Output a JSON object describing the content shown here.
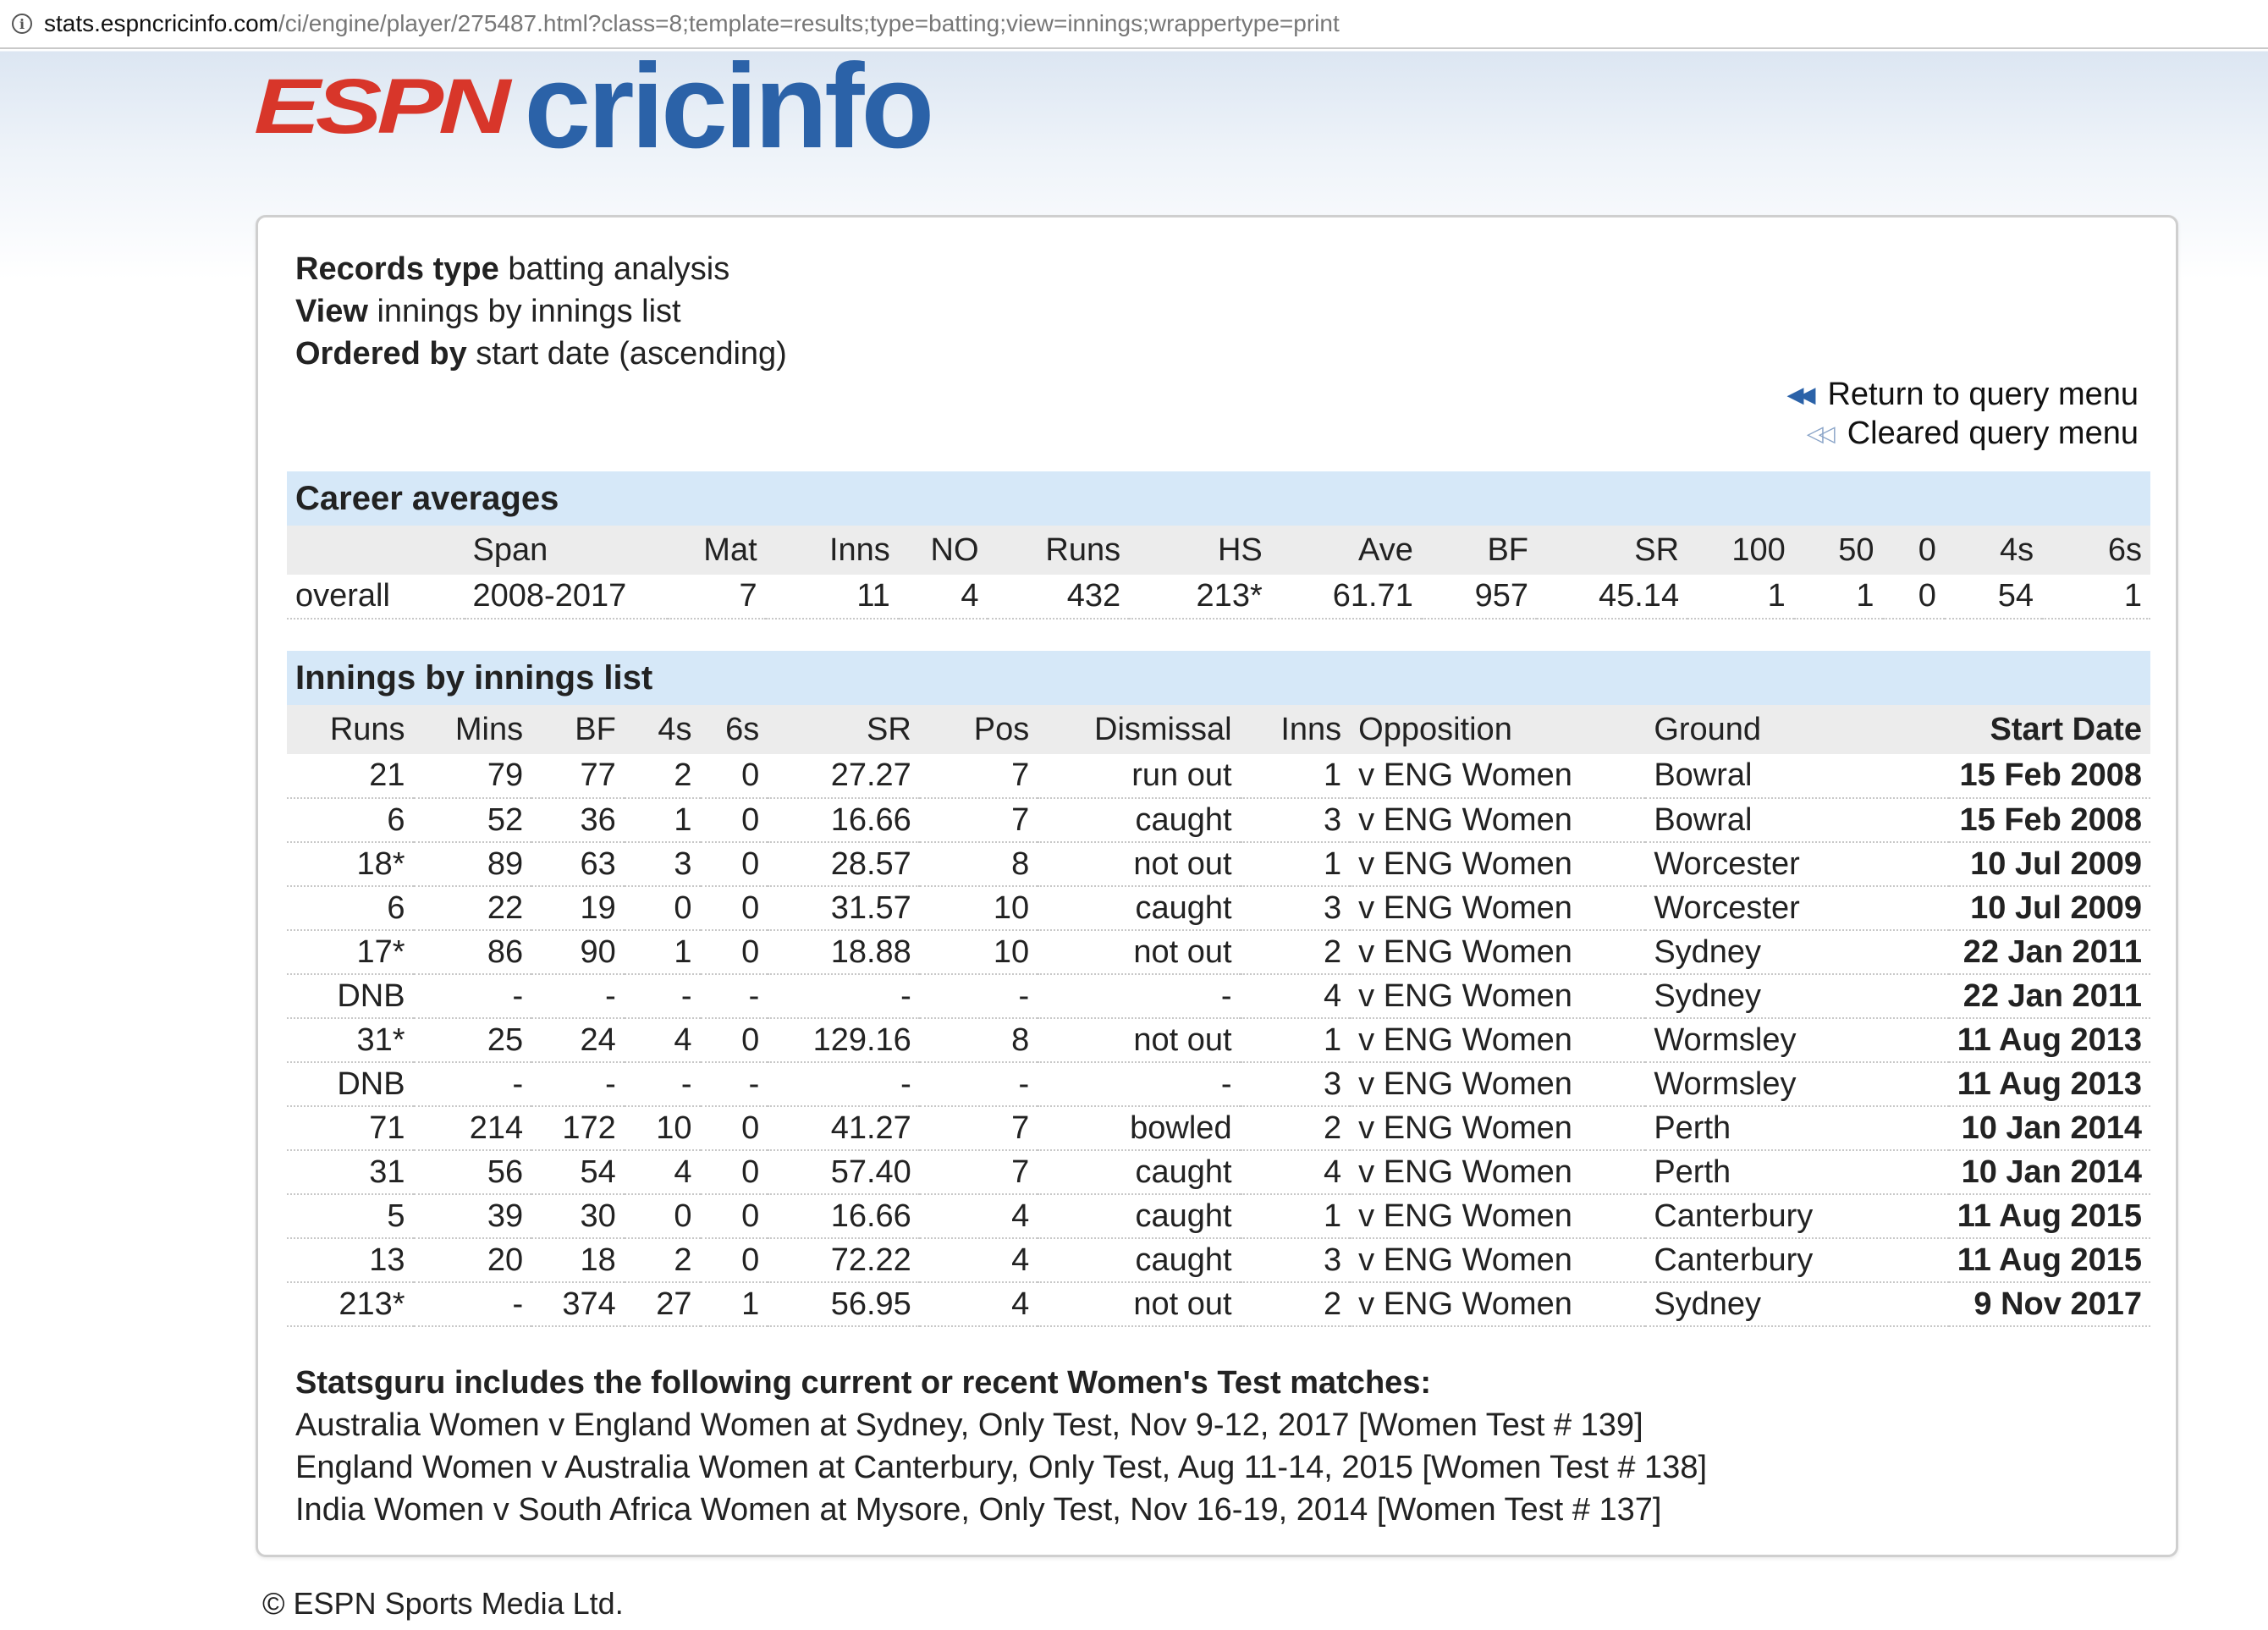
{
  "browser": {
    "url_host": "stats.espncricinfo.com",
    "url_path": "/ci/engine/player/275487.html?class=8;template=results;type=batting;view=innings;wrappertype=print"
  },
  "logo": {
    "espn": "ESPN",
    "cricinfo": "cricinfo"
  },
  "meta": {
    "records_type_label": "Records type",
    "records_type_value": "batting analysis",
    "view_label": "View",
    "view_value": "innings by innings list",
    "ordered_by_label": "Ordered by",
    "ordered_by_value": "start date (ascending)"
  },
  "links": {
    "return": "Return to query menu",
    "cleared": "Cleared query menu"
  },
  "career": {
    "title": "Career averages",
    "headers": [
      "",
      "Span",
      "Mat",
      "Inns",
      "NO",
      "Runs",
      "HS",
      "Ave",
      "BF",
      "SR",
      "100",
      "50",
      "0",
      "4s",
      "6s"
    ],
    "row": [
      "overall",
      "2008-2017",
      "7",
      "11",
      "4",
      "432",
      "213*",
      "61.71",
      "957",
      "45.14",
      "1",
      "1",
      "0",
      "54",
      "1"
    ]
  },
  "innings": {
    "title": "Innings by innings list",
    "headers": [
      "Runs",
      "Mins",
      "BF",
      "4s",
      "6s",
      "SR",
      "Pos",
      "Dismissal",
      "Inns",
      "Opposition",
      "Ground",
      "Start Date"
    ],
    "rows": [
      [
        "21",
        "79",
        "77",
        "2",
        "0",
        "27.27",
        "7",
        "run out",
        "1",
        "v ENG Women",
        "Bowral",
        "15 Feb 2008"
      ],
      [
        "6",
        "52",
        "36",
        "1",
        "0",
        "16.66",
        "7",
        "caught",
        "3",
        "v ENG Women",
        "Bowral",
        "15 Feb 2008"
      ],
      [
        "18*",
        "89",
        "63",
        "3",
        "0",
        "28.57",
        "8",
        "not out",
        "1",
        "v ENG Women",
        "Worcester",
        "10 Jul 2009"
      ],
      [
        "6",
        "22",
        "19",
        "0",
        "0",
        "31.57",
        "10",
        "caught",
        "3",
        "v ENG Women",
        "Worcester",
        "10 Jul 2009"
      ],
      [
        "17*",
        "86",
        "90",
        "1",
        "0",
        "18.88",
        "10",
        "not out",
        "2",
        "v ENG Women",
        "Sydney",
        "22 Jan 2011"
      ],
      [
        "DNB",
        "-",
        "-",
        "-",
        "-",
        "-",
        "-",
        "-",
        "4",
        "v ENG Women",
        "Sydney",
        "22 Jan 2011"
      ],
      [
        "31*",
        "25",
        "24",
        "4",
        "0",
        "129.16",
        "8",
        "not out",
        "1",
        "v ENG Women",
        "Wormsley",
        "11 Aug 2013"
      ],
      [
        "DNB",
        "-",
        "-",
        "-",
        "-",
        "-",
        "-",
        "-",
        "3",
        "v ENG Women",
        "Wormsley",
        "11 Aug 2013"
      ],
      [
        "71",
        "214",
        "172",
        "10",
        "0",
        "41.27",
        "7",
        "bowled",
        "2",
        "v ENG Women",
        "Perth",
        "10 Jan 2014"
      ],
      [
        "31",
        "56",
        "54",
        "4",
        "0",
        "57.40",
        "7",
        "caught",
        "4",
        "v ENG Women",
        "Perth",
        "10 Jan 2014"
      ],
      [
        "5",
        "39",
        "30",
        "0",
        "0",
        "16.66",
        "4",
        "caught",
        "1",
        "v ENG Women",
        "Canterbury",
        "11 Aug 2015"
      ],
      [
        "13",
        "20",
        "18",
        "2",
        "0",
        "72.22",
        "4",
        "caught",
        "3",
        "v ENG Women",
        "Canterbury",
        "11 Aug 2015"
      ],
      [
        "213*",
        "-",
        "374",
        "27",
        "1",
        "56.95",
        "4",
        "not out",
        "2",
        "v ENG Women",
        "Sydney",
        "9 Nov 2017"
      ]
    ]
  },
  "recent": {
    "title": "Statsguru includes the following current or recent Women's Test matches:",
    "items": [
      "Australia Women v England Women at Sydney, Only Test, Nov 9-12, 2017 [Women Test # 139]",
      "England Women v Australia Women at Canterbury, Only Test, Aug 11-14, 2015 [Women Test # 138]",
      "India Women v South Africa Women at Mysore, Only Test, Nov 16-19, 2014 [Women Test # 137]"
    ]
  },
  "footer": "© ESPN Sports Media Ltd.",
  "colors": {
    "section_header_bg": "#d6e8f8",
    "table_header_bg": "#ececec",
    "espn_red": "#d8362a",
    "cricinfo_blue": "#2b62a8"
  }
}
